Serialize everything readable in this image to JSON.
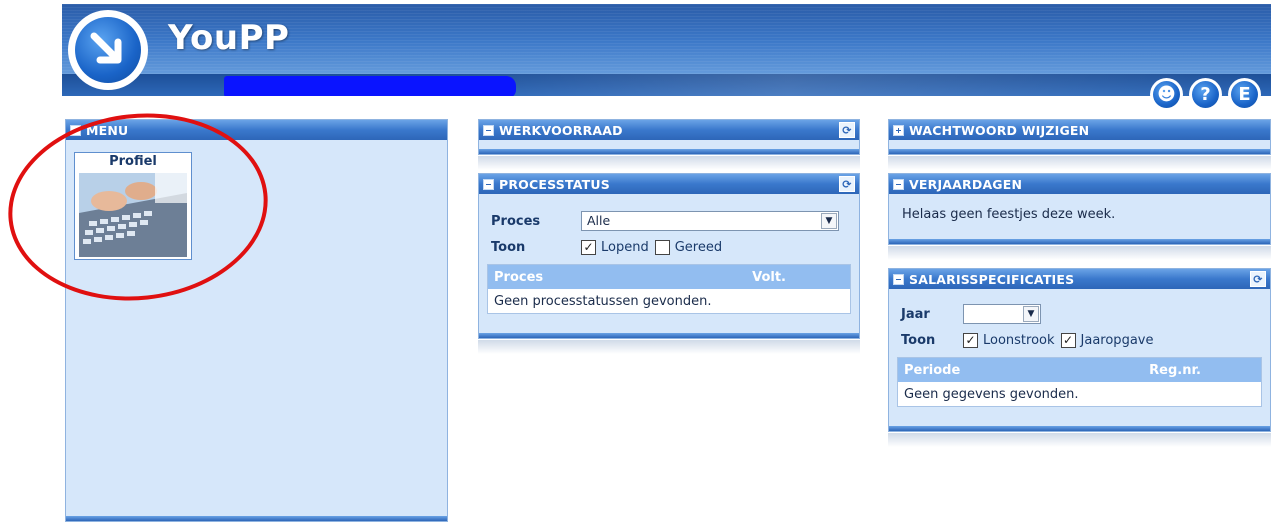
{
  "app": {
    "title": "YouPP",
    "brand_color": "#2d66b8"
  },
  "header_icons": [
    {
      "name": "user-settings-icon",
      "glyph": "☻"
    },
    {
      "name": "help-icon",
      "glyph": "?"
    },
    {
      "name": "exit-icon",
      "glyph": "E"
    }
  ],
  "menu": {
    "title": "MENU",
    "tiles": [
      {
        "label": "Profiel",
        "icon": "keyboard-image"
      }
    ]
  },
  "werkvoorraad": {
    "title": "WERKVOORRAAD"
  },
  "processtatus": {
    "title": "PROCESSTATUS",
    "proces_label": "Proces",
    "proces_value": "Alle",
    "toon_label": "Toon",
    "checkbox_lopend": {
      "label": "Lopend",
      "checked": true
    },
    "checkbox_gereed": {
      "label": "Gereed",
      "checked": false
    },
    "columns": [
      "Proces",
      "Volt."
    ],
    "empty_message": "Geen processtatussen gevonden."
  },
  "wachtwoord": {
    "title": "WACHTWOORD WIJZIGEN"
  },
  "verjaardagen": {
    "title": "VERJAARDAGEN",
    "message": "Helaas geen feestjes deze week."
  },
  "salaris": {
    "title": "SALARISSPECIFICATIES",
    "jaar_label": "Jaar",
    "jaar_value": "",
    "toon_label": "Toon",
    "checkbox_loonstrook": {
      "label": "Loonstrook",
      "checked": true
    },
    "checkbox_jaaropgave": {
      "label": "Jaaropgave",
      "checked": true
    },
    "columns": [
      "Periode",
      "Reg.nr."
    ],
    "empty_message": "Geen gegevens gevonden."
  },
  "annotation_color": "#e01010"
}
